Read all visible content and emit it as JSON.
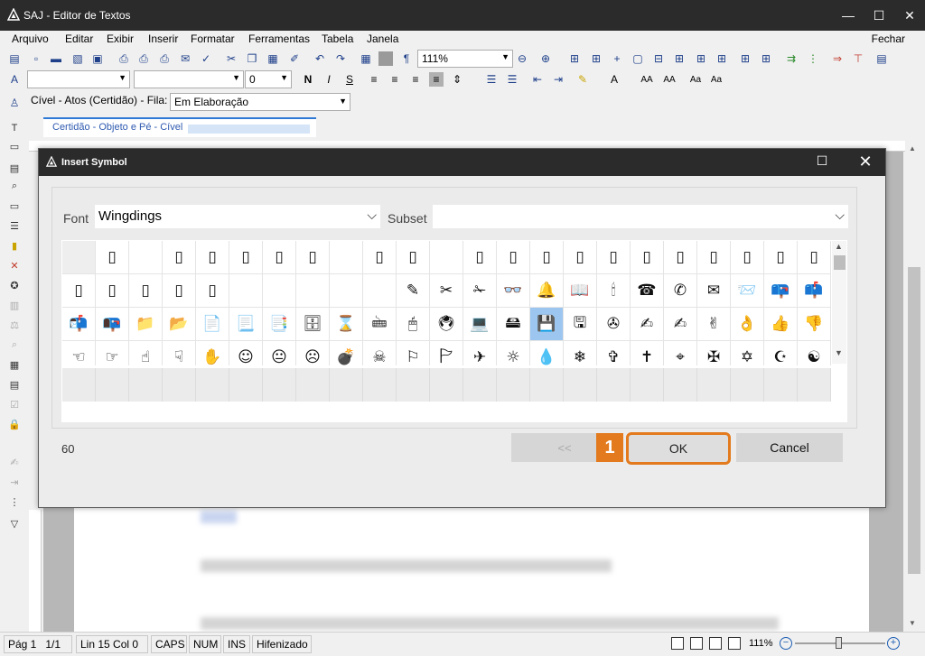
{
  "window": {
    "title": "SAJ - Editor de Textos",
    "min": "—",
    "max": "☐",
    "close": "✕"
  },
  "menu": {
    "items": [
      "Arquivo",
      "Editar",
      "Exibir",
      "Inserir",
      "Formatar",
      "Ferramentas",
      "Tabela",
      "Janela"
    ],
    "close_label": "Fechar"
  },
  "toolbar": {
    "zoom_value": "111%",
    "font_size_value": "0"
  },
  "queue": {
    "label": "Cível - Atos (Certidão) - Fila:",
    "value": "Em Elaboração"
  },
  "document_tab": {
    "label": "Certidão - Objeto e Pé - Cível"
  },
  "dialog": {
    "title": "Insert Symbol",
    "font_label": "Font",
    "font_value": "Wingdings",
    "subset_label": "Subset",
    "subset_value": "",
    "char_code": "60",
    "prev_label": "<<",
    "ok_label": "OK",
    "cancel_label": "Cancel",
    "callout_number": "1",
    "symbols": [
      "",
      "▯",
      "",
      "▯",
      "▯",
      "▯",
      "▯",
      "▯",
      "",
      "▯",
      "▯",
      "",
      "▯",
      "▯",
      "▯",
      "▯",
      "▯",
      "▯",
      "▯",
      "▯",
      "▯",
      "▯",
      "▯",
      "▯",
      "▯",
      "▯",
      "▯",
      "▯",
      "",
      "",
      "",
      "",
      "",
      "✎",
      "✂",
      "✁",
      "👓",
      "🔔",
      "📖",
      "🕯",
      "☎",
      "✆",
      "✉",
      "📨",
      "📪",
      "📫",
      "📬",
      "📭",
      "📁",
      "📂",
      "📄",
      "📃",
      "📑",
      "🗄",
      "⌛",
      "🖮",
      "🖱",
      "🖲",
      "💻",
      "🖴",
      "💾",
      "🖫",
      "✇",
      "✍",
      "✍",
      "✌",
      "👌",
      "👍",
      "👎",
      "☜",
      "☞",
      "☝",
      "☟",
      "✋",
      "☺",
      "😐",
      "☹",
      "💣",
      "☠",
      "⚐",
      "🏱",
      "✈",
      "☼",
      "💧",
      "❄",
      "✞",
      "✝",
      "⌖",
      "✠",
      "✡",
      "☪",
      "☯"
    ],
    "selected_index": 60,
    "colors": {
      "accent": "#e37a1d",
      "selection": "#9cc6ef"
    }
  },
  "status": {
    "page": "Pág 1",
    "page_count": "1/1",
    "line_col": "Lin 15  Col 0",
    "caps": "CAPS",
    "num": "NUM",
    "ins": "INS",
    "hyphen": "Hifenizado",
    "zoom": "111%"
  }
}
